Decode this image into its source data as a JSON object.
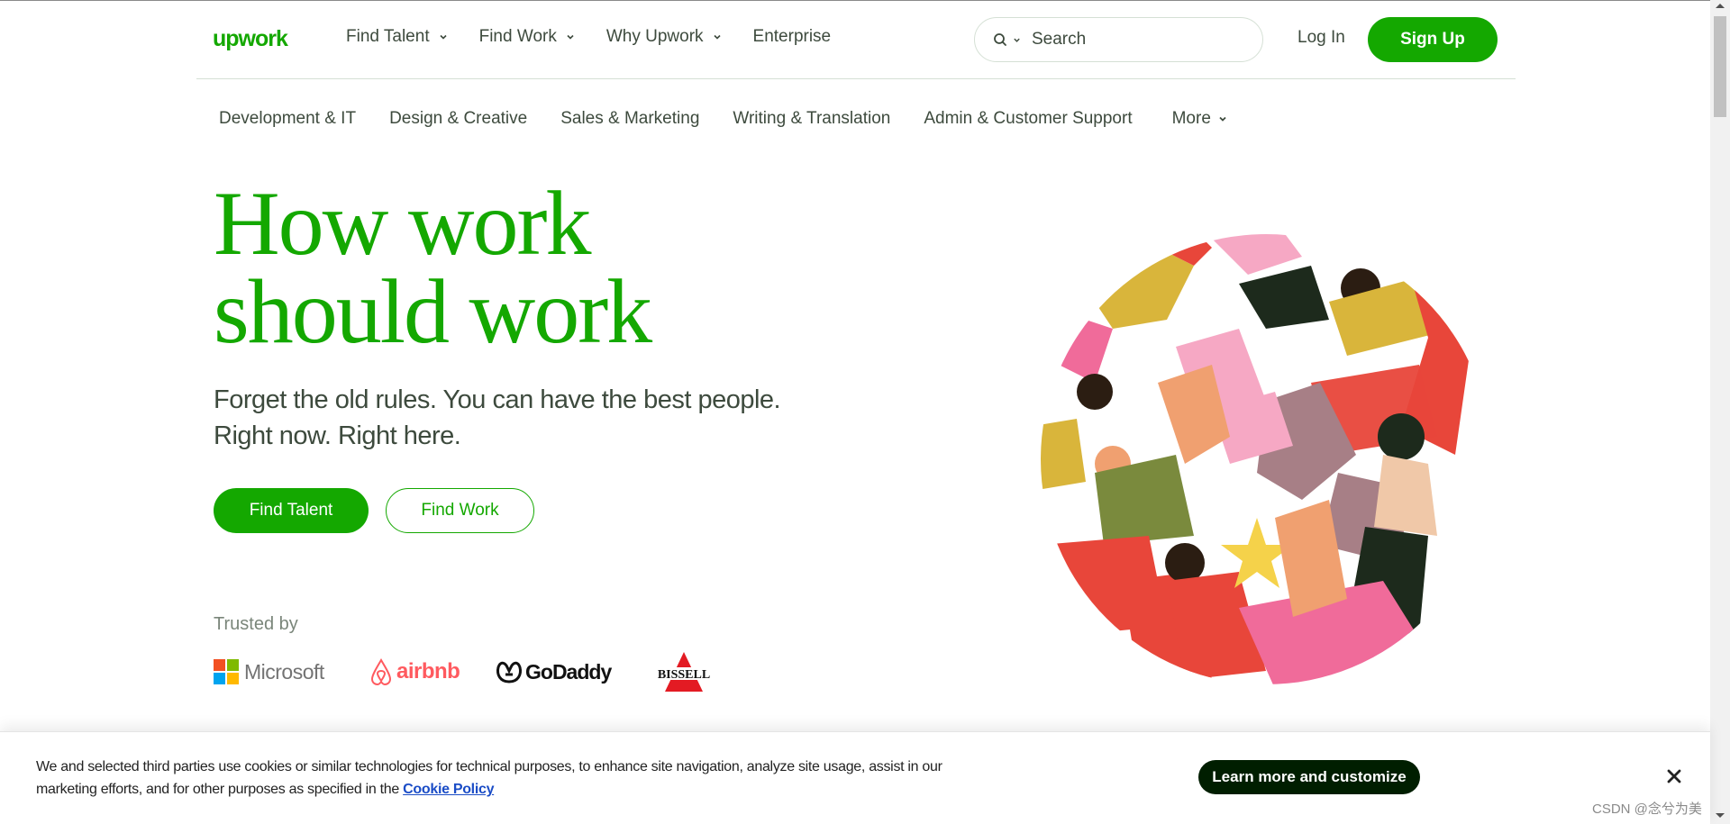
{
  "header": {
    "logo_text": "upwork",
    "nav": [
      {
        "label": "Find Talent",
        "has_dropdown": true
      },
      {
        "label": "Find Work",
        "has_dropdown": true
      },
      {
        "label": "Why Upwork",
        "has_dropdown": true
      },
      {
        "label": "Enterprise",
        "has_dropdown": false
      }
    ],
    "search_placeholder": "Search",
    "login_label": "Log In",
    "signup_label": "Sign Up"
  },
  "categories": [
    "Development & IT",
    "Design & Creative",
    "Sales & Marketing",
    "Writing & Translation",
    "Admin & Customer Support"
  ],
  "categories_more": "More",
  "hero": {
    "title_line1": "How work",
    "title_line2": "should work",
    "subtitle_line1": "Forget the old rules. You can have the best people.",
    "subtitle_line2": "Right now. Right here.",
    "find_talent_label": "Find Talent",
    "find_work_label": "Find Work"
  },
  "trusted": {
    "label": "Trusted by",
    "brands": [
      "Microsoft",
      "airbnb",
      "GoDaddy",
      "BISSELL"
    ]
  },
  "cookie": {
    "text": "We and selected third parties use cookies or similar technologies for technical purposes, to enhance site navigation, analyze site usage, assist in our marketing efforts, and for other purposes as specified in the",
    "link": "Cookie Policy",
    "button": "Learn more and customize"
  },
  "watermark": "CSDN @念兮为美",
  "colors": {
    "brand_green": "#14a800",
    "dark": "#001e00",
    "text": "#3d4a3d",
    "link": "#1a4cc6"
  },
  "icons": {
    "search": "search-icon",
    "chevron": "chevron-down-icon",
    "close": "close-icon"
  }
}
